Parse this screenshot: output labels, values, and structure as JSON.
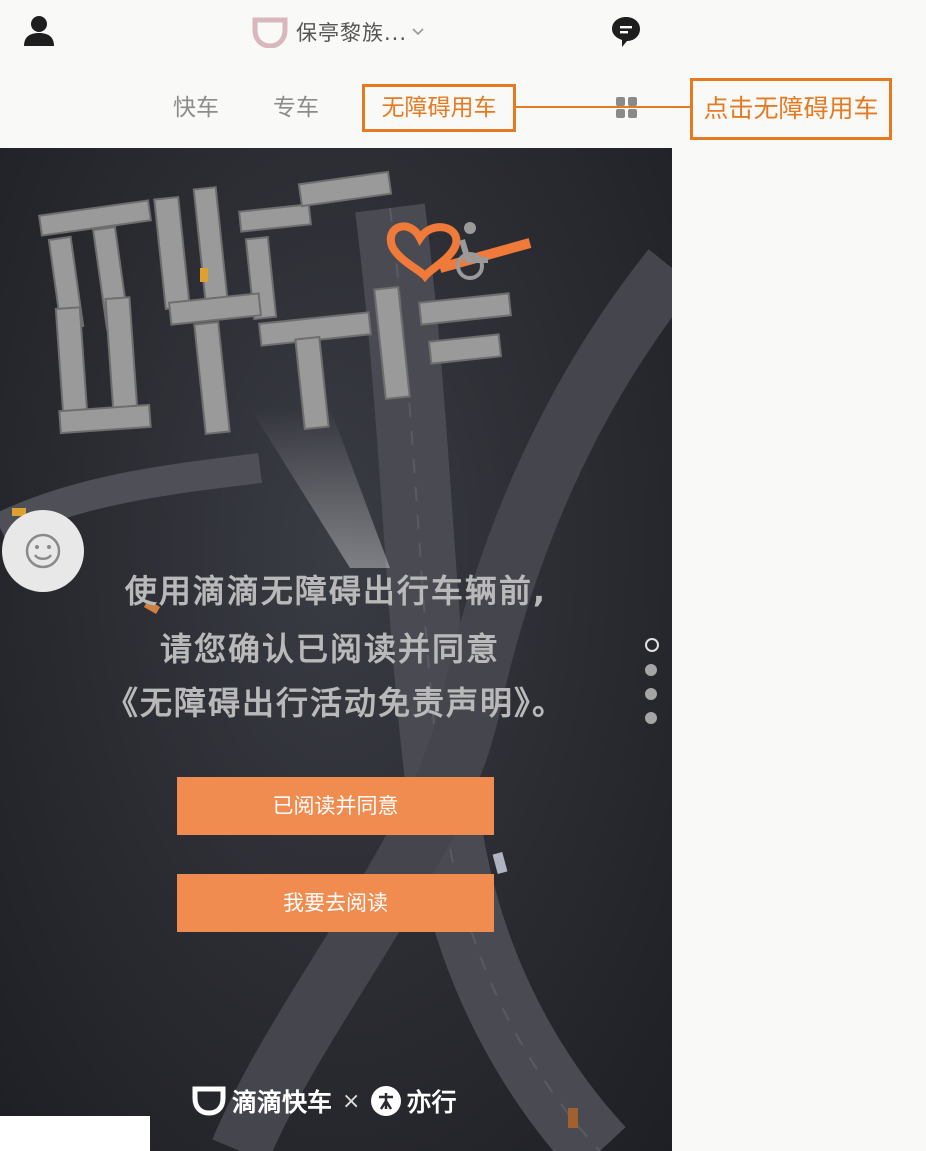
{
  "header": {
    "location_text": "保亭黎族...",
    "user_icon": "user-icon",
    "message_icon": "message-icon"
  },
  "tabs": [
    {
      "label": "快车"
    },
    {
      "label": "专车"
    },
    {
      "label": "无障碍用车"
    }
  ],
  "callout": {
    "label": "点击无障碍用车"
  },
  "banner": {
    "headline_art": "深圳有爱 出行无碍",
    "notice_line1": "使用滴滴无障碍出行车辆前,",
    "notice_line2": "请您确认已阅读并同意",
    "notice_line3": "《无障碍出行活动免责声明》。",
    "agree_button": "已阅读并同意",
    "read_button": "我要去阅读",
    "footer_brand1": "滴滴快车",
    "footer_x": "×",
    "footer_brand2": "亦行",
    "pager_count": 4,
    "pager_active": 0
  },
  "colors": {
    "accent": "#e67a22",
    "button": "#f08c50",
    "banner_bg": "#2a2b31",
    "page_bg": "#f9f9f7"
  }
}
